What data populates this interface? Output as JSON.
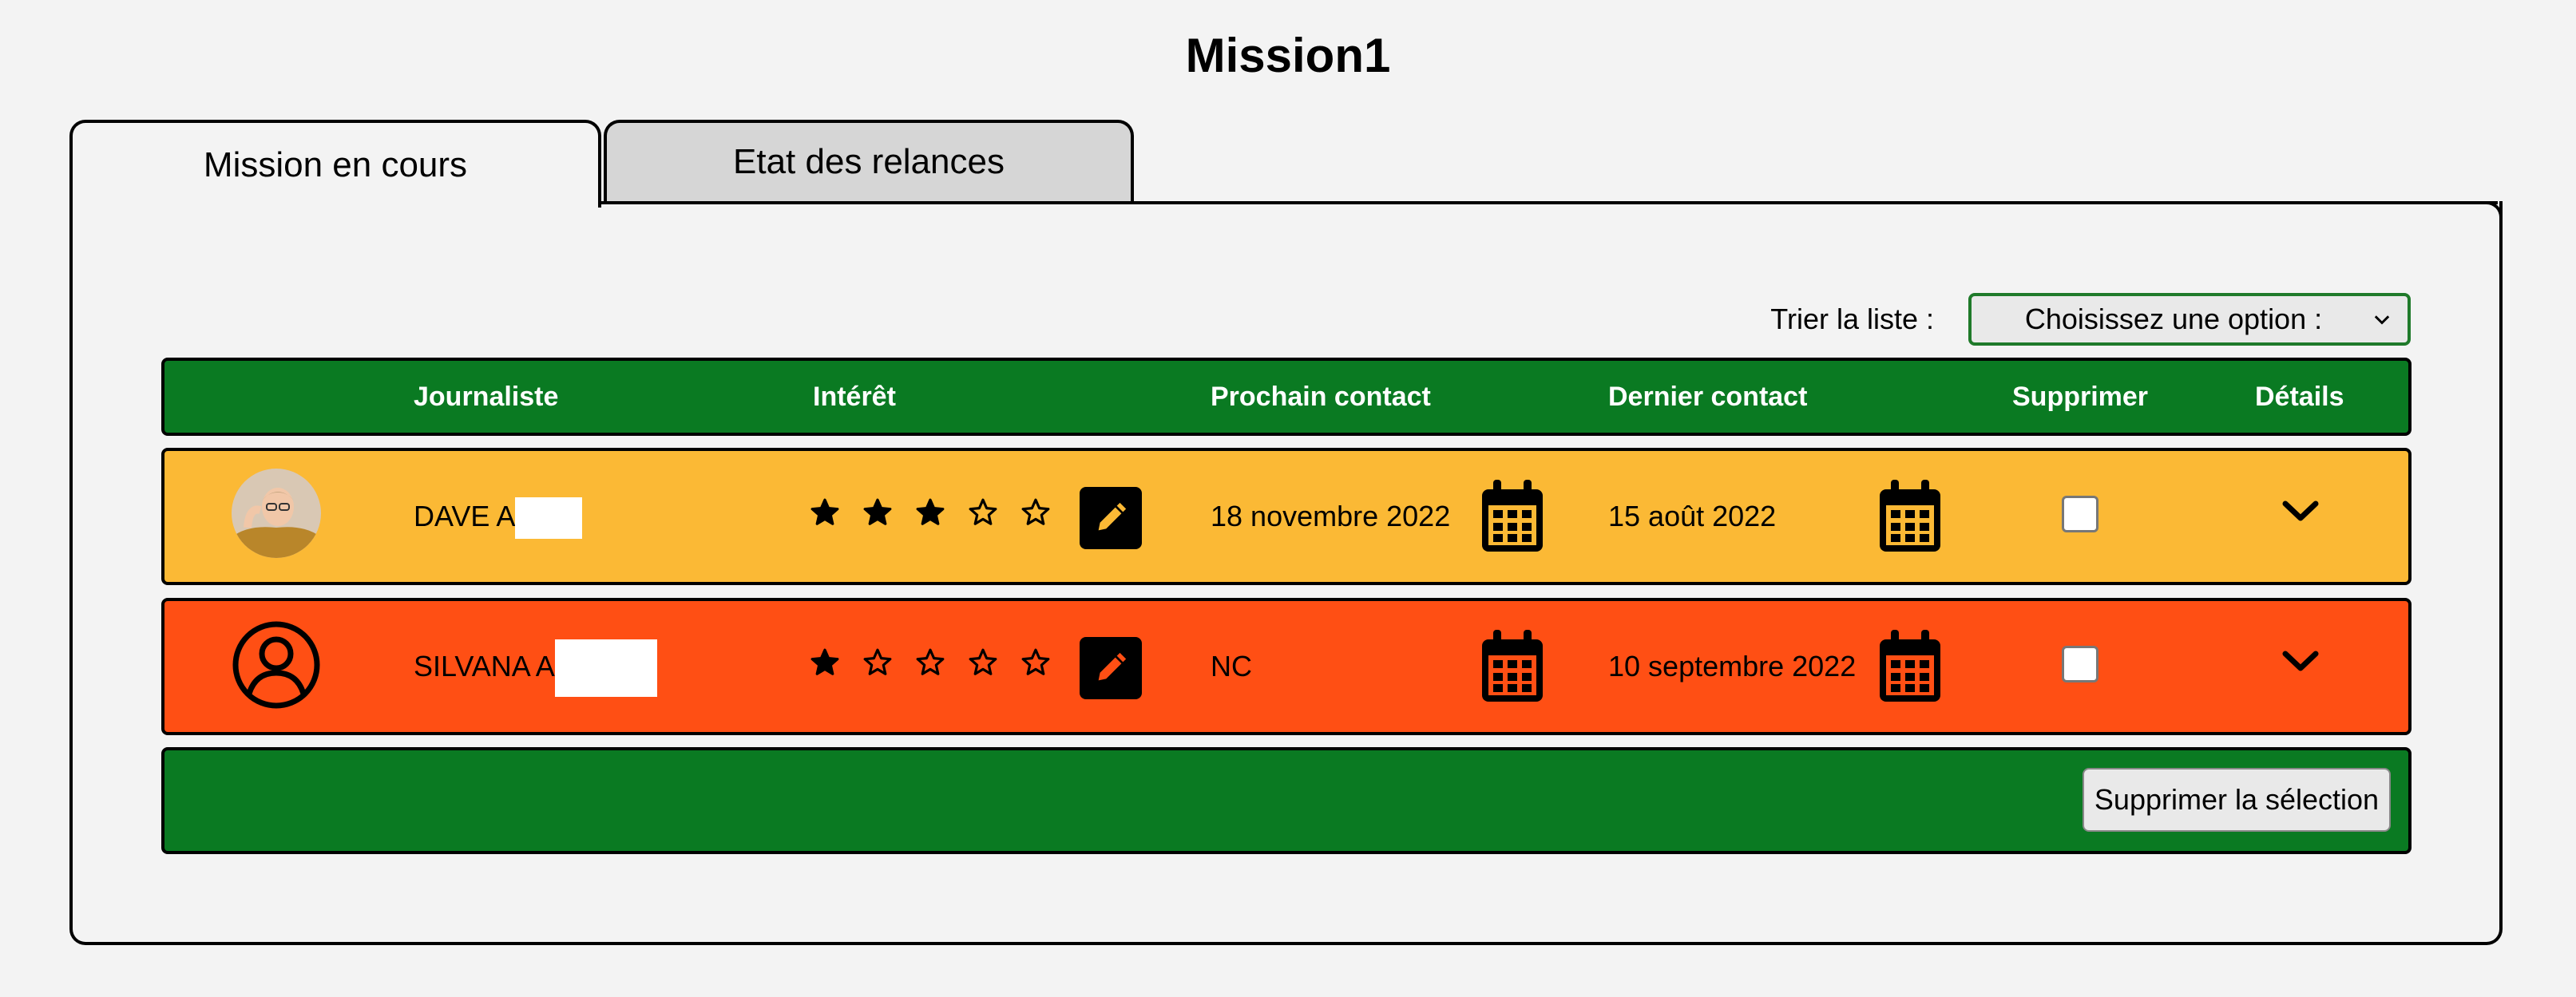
{
  "page": {
    "title": "Mission1"
  },
  "tabs": [
    {
      "label": "Mission en cours",
      "active": true
    },
    {
      "label": "Etat des relances",
      "active": false
    }
  ],
  "sort": {
    "label": "Trier la liste :",
    "selected": "Choisissez une option :"
  },
  "table": {
    "headers": {
      "journaliste": "Journaliste",
      "interet": "Intérêt",
      "prochain": "Prochain contact",
      "dernier": "Dernier contact",
      "supprimer": "Supprimer",
      "details": "Détails"
    },
    "rows": [
      {
        "name": "DAVE A",
        "avatar": "photo",
        "rating": 3,
        "rating_max": 5,
        "next_contact": "18 novembre 2022",
        "last_contact": "15 août 2022",
        "selected": false,
        "color": "#fbb935"
      },
      {
        "name": "SILVANA A",
        "avatar": "user-outline-icon",
        "rating": 1,
        "rating_max": 5,
        "next_contact": "NC",
        "last_contact": "10 septembre 2022",
        "selected": false,
        "color": "#ff4f14"
      }
    ]
  },
  "footer": {
    "delete_selection_label": "Supprimer la sélection"
  },
  "colors": {
    "header_green": "#0a7a22",
    "row_warm": "#fbb935",
    "row_hot": "#ff4f14",
    "background": "#f3f3f3"
  }
}
